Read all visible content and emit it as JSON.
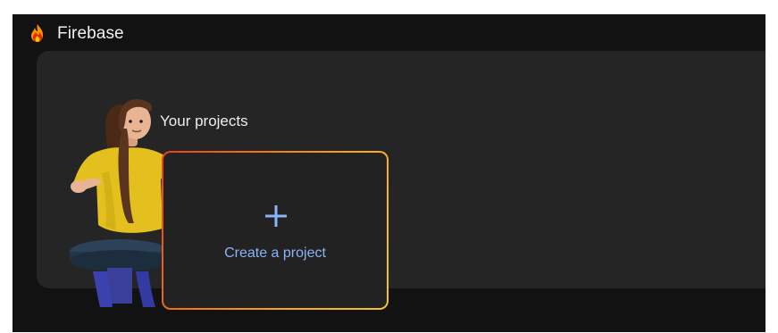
{
  "app": {
    "name": "Firebase",
    "logo_icon": "firebase-flame-icon"
  },
  "projects": {
    "title": "Your projects",
    "create_card": {
      "label": "Create a project",
      "icon": "plus-icon",
      "accent_color": "#8ab4f8",
      "border_gradient": [
        "#e8401a",
        "#f07a18",
        "#f8a81c",
        "#f5c22c"
      ]
    }
  },
  "colors": {
    "background": "#121212",
    "panel": "#252526",
    "card": "#222222",
    "text": "#f1f1f1"
  }
}
